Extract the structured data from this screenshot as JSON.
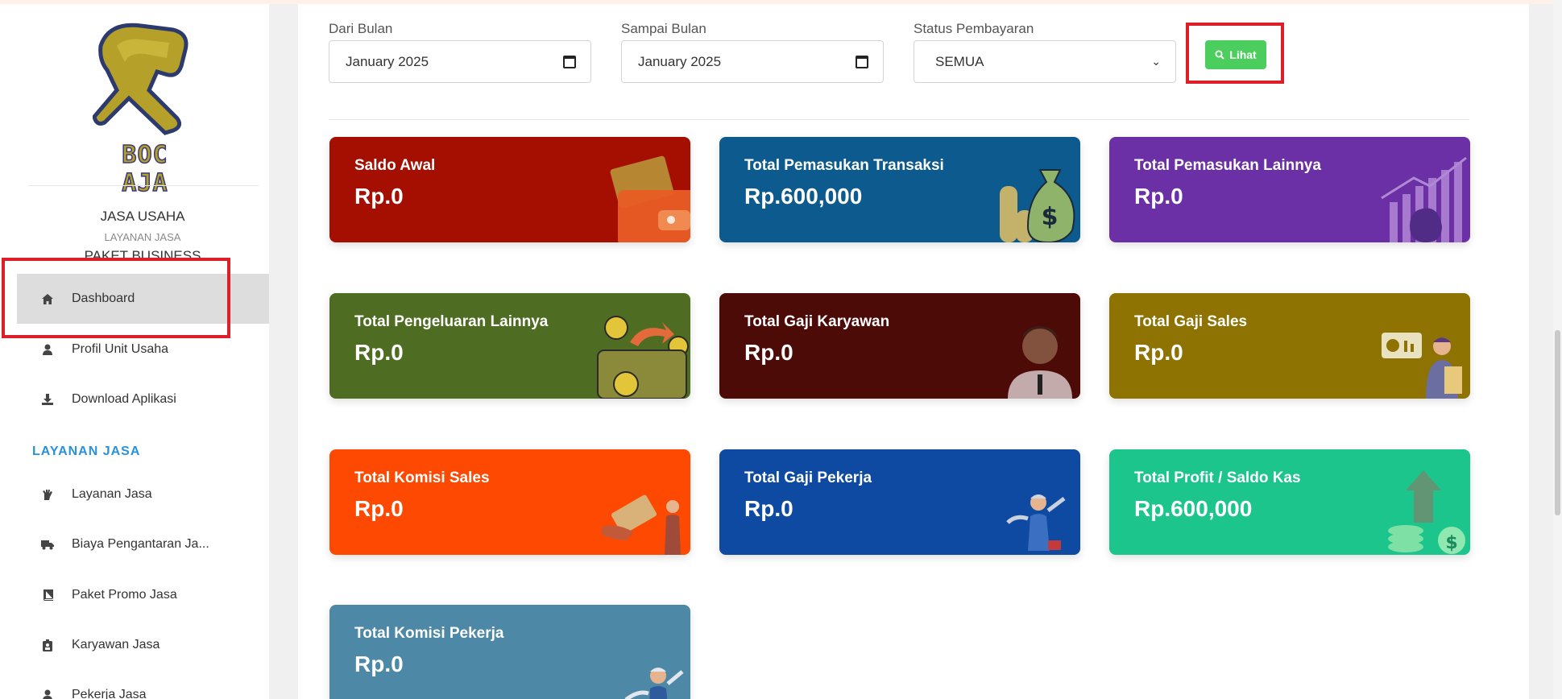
{
  "sidebar": {
    "logo_text": "BOC AJA",
    "org_name": "JASA USAHA",
    "org_sub": "LAYANAN JASA",
    "org_package": "PAKET BUSINESS",
    "items": [
      {
        "label": "Dashboard",
        "icon": "home-icon"
      },
      {
        "label": "Profil Unit Usaha",
        "icon": "user-icon"
      },
      {
        "label": "Download Aplikasi",
        "icon": "download-icon"
      }
    ],
    "section_title": "LAYANAN JASA",
    "section_items": [
      {
        "label": "Layanan Jasa",
        "icon": "hand-icon"
      },
      {
        "label": "Biaya Pengantaran Ja...",
        "icon": "truck-icon"
      },
      {
        "label": "Paket Promo Jasa",
        "icon": "book-icon"
      },
      {
        "label": "Karyawan Jasa",
        "icon": "id-badge-icon"
      },
      {
        "label": "Pekerja Jasa",
        "icon": "user-icon"
      }
    ]
  },
  "filters": {
    "from_label": "Dari Bulan",
    "from_value": "January 2025",
    "to_label": "Sampai Bulan",
    "to_value": "January 2025",
    "status_label": "Status Pembayaran",
    "status_value": "SEMUA",
    "button_label": "Lihat"
  },
  "cards": [
    {
      "title": "Saldo Awal",
      "value": "Rp.0",
      "color": "#a50f02"
    },
    {
      "title": "Total Pemasukan Transaksi",
      "value": "Rp.600,000",
      "color": "#0d5a8e"
    },
    {
      "title": "Total Pemasukan Lainnya",
      "value": "Rp.0",
      "color": "#6b2fa6"
    },
    {
      "title": "Total Pengeluaran Lainnya",
      "value": "Rp.0",
      "color": "#4e6d23"
    },
    {
      "title": "Total Gaji Karyawan",
      "value": "Rp.0",
      "color": "#4d0b08"
    },
    {
      "title": "Total Gaji Sales",
      "value": "Rp.0",
      "color": "#8e7303"
    },
    {
      "title": "Total Komisi Sales",
      "value": "Rp.0",
      "color": "#fd4902"
    },
    {
      "title": "Total Gaji Pekerja",
      "value": "Rp.0",
      "color": "#0e4aa2"
    },
    {
      "title": "Total Profit / Saldo Kas",
      "value": "Rp.600,000",
      "color": "#1bc58c"
    },
    {
      "title": "Total Komisi Pekerja",
      "value": "Rp.0",
      "color": "#4d88a6"
    }
  ]
}
